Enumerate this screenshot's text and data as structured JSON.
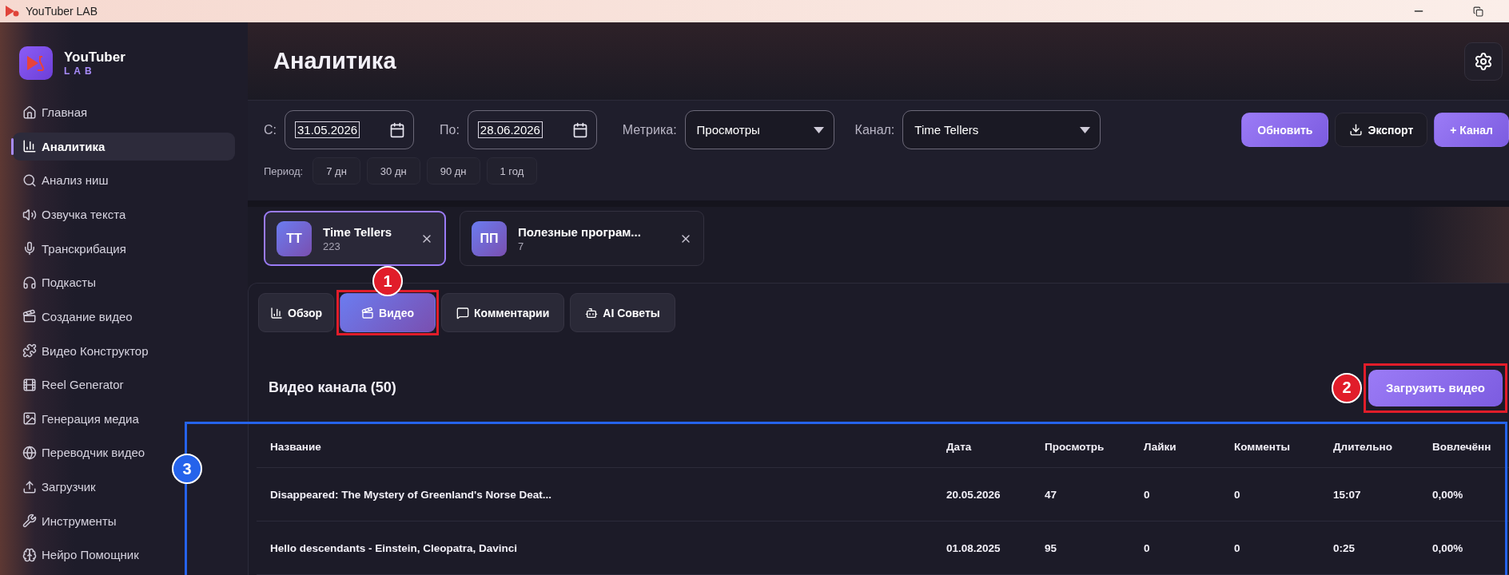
{
  "title_bar": {
    "title": "YouTuber LAB"
  },
  "sidebar": {
    "logo": {
      "name": "YouTuber",
      "sub": "LAB"
    },
    "items": [
      {
        "label": "Главная",
        "selected": false
      },
      {
        "label": "Аналитика",
        "selected": true
      },
      {
        "label": "Анализ ниш",
        "selected": false
      },
      {
        "label": "Озвучка текста",
        "selected": false
      },
      {
        "label": "Транскрибация",
        "selected": false
      },
      {
        "label": "Подкасты",
        "selected": false
      },
      {
        "label": "Создание видео",
        "selected": false
      },
      {
        "label": "Видео Конструктор",
        "selected": false
      },
      {
        "label": "Reel Generator",
        "selected": false
      },
      {
        "label": "Генерация медиа",
        "selected": false
      },
      {
        "label": "Переводчик видео",
        "selected": false
      },
      {
        "label": "Загрузчик",
        "selected": false
      },
      {
        "label": "Инструменты",
        "selected": false
      },
      {
        "label": "Нейро Помощник",
        "selected": false
      }
    ]
  },
  "header": {
    "title": "Аналитика"
  },
  "filters": {
    "from_label": "С:",
    "from_value": "31.05.2026",
    "to_label": "По:",
    "to_value": "28.06.2026",
    "metric_label": "Метрика:",
    "metric_value": "Просмотры",
    "channel_label": "Канал:",
    "channel_value": "Time Tellers",
    "buttons": [
      {
        "label": "Обновить",
        "kind": "primary"
      },
      {
        "label": "Экспорт",
        "kind": "export"
      },
      {
        "label": "+ Канал",
        "kind": "primary"
      }
    ],
    "period_label": "Период:",
    "periods": [
      "7 дн",
      "30 дн",
      "90 дн",
      "1 год"
    ]
  },
  "channels": [
    {
      "initials": "TT",
      "name": "Time Tellers",
      "count": "223",
      "selected": true
    },
    {
      "initials": "ПП",
      "name": "Полезные програм...",
      "count": "7",
      "selected": false
    }
  ],
  "tabs": [
    {
      "label": "Обзор",
      "selected": false
    },
    {
      "label": "Видео",
      "selected": true,
      "callout": {
        "number": "1",
        "color": "#e11d2a"
      }
    },
    {
      "label": "Комментарии",
      "selected": false
    },
    {
      "label": "AI Советы",
      "selected": false
    }
  ],
  "videos": {
    "title": "Видео канала (50)",
    "upload_button": {
      "label": "Загрузить видео",
      "callout": {
        "number": "2",
        "color": "#e11d2a"
      }
    },
    "table_callout": {
      "number": "3",
      "color": "#2563eb"
    },
    "columns": [
      "Название",
      "Дата",
      "Просмотрь",
      "Лайки",
      "Комменты",
      "Длительно",
      "Вовлечённ"
    ],
    "rows": [
      [
        "Disappeared: The Mystery of Greenland's Norse Deat...",
        "20.05.2026",
        "47",
        "0",
        "0",
        "15:07",
        "0,00%"
      ],
      [
        "Hello descendants - Einstein, Cleopatra, Davinci",
        "01.08.2025",
        "95",
        "0",
        "0",
        "0:25",
        "0,00%"
      ]
    ]
  }
}
